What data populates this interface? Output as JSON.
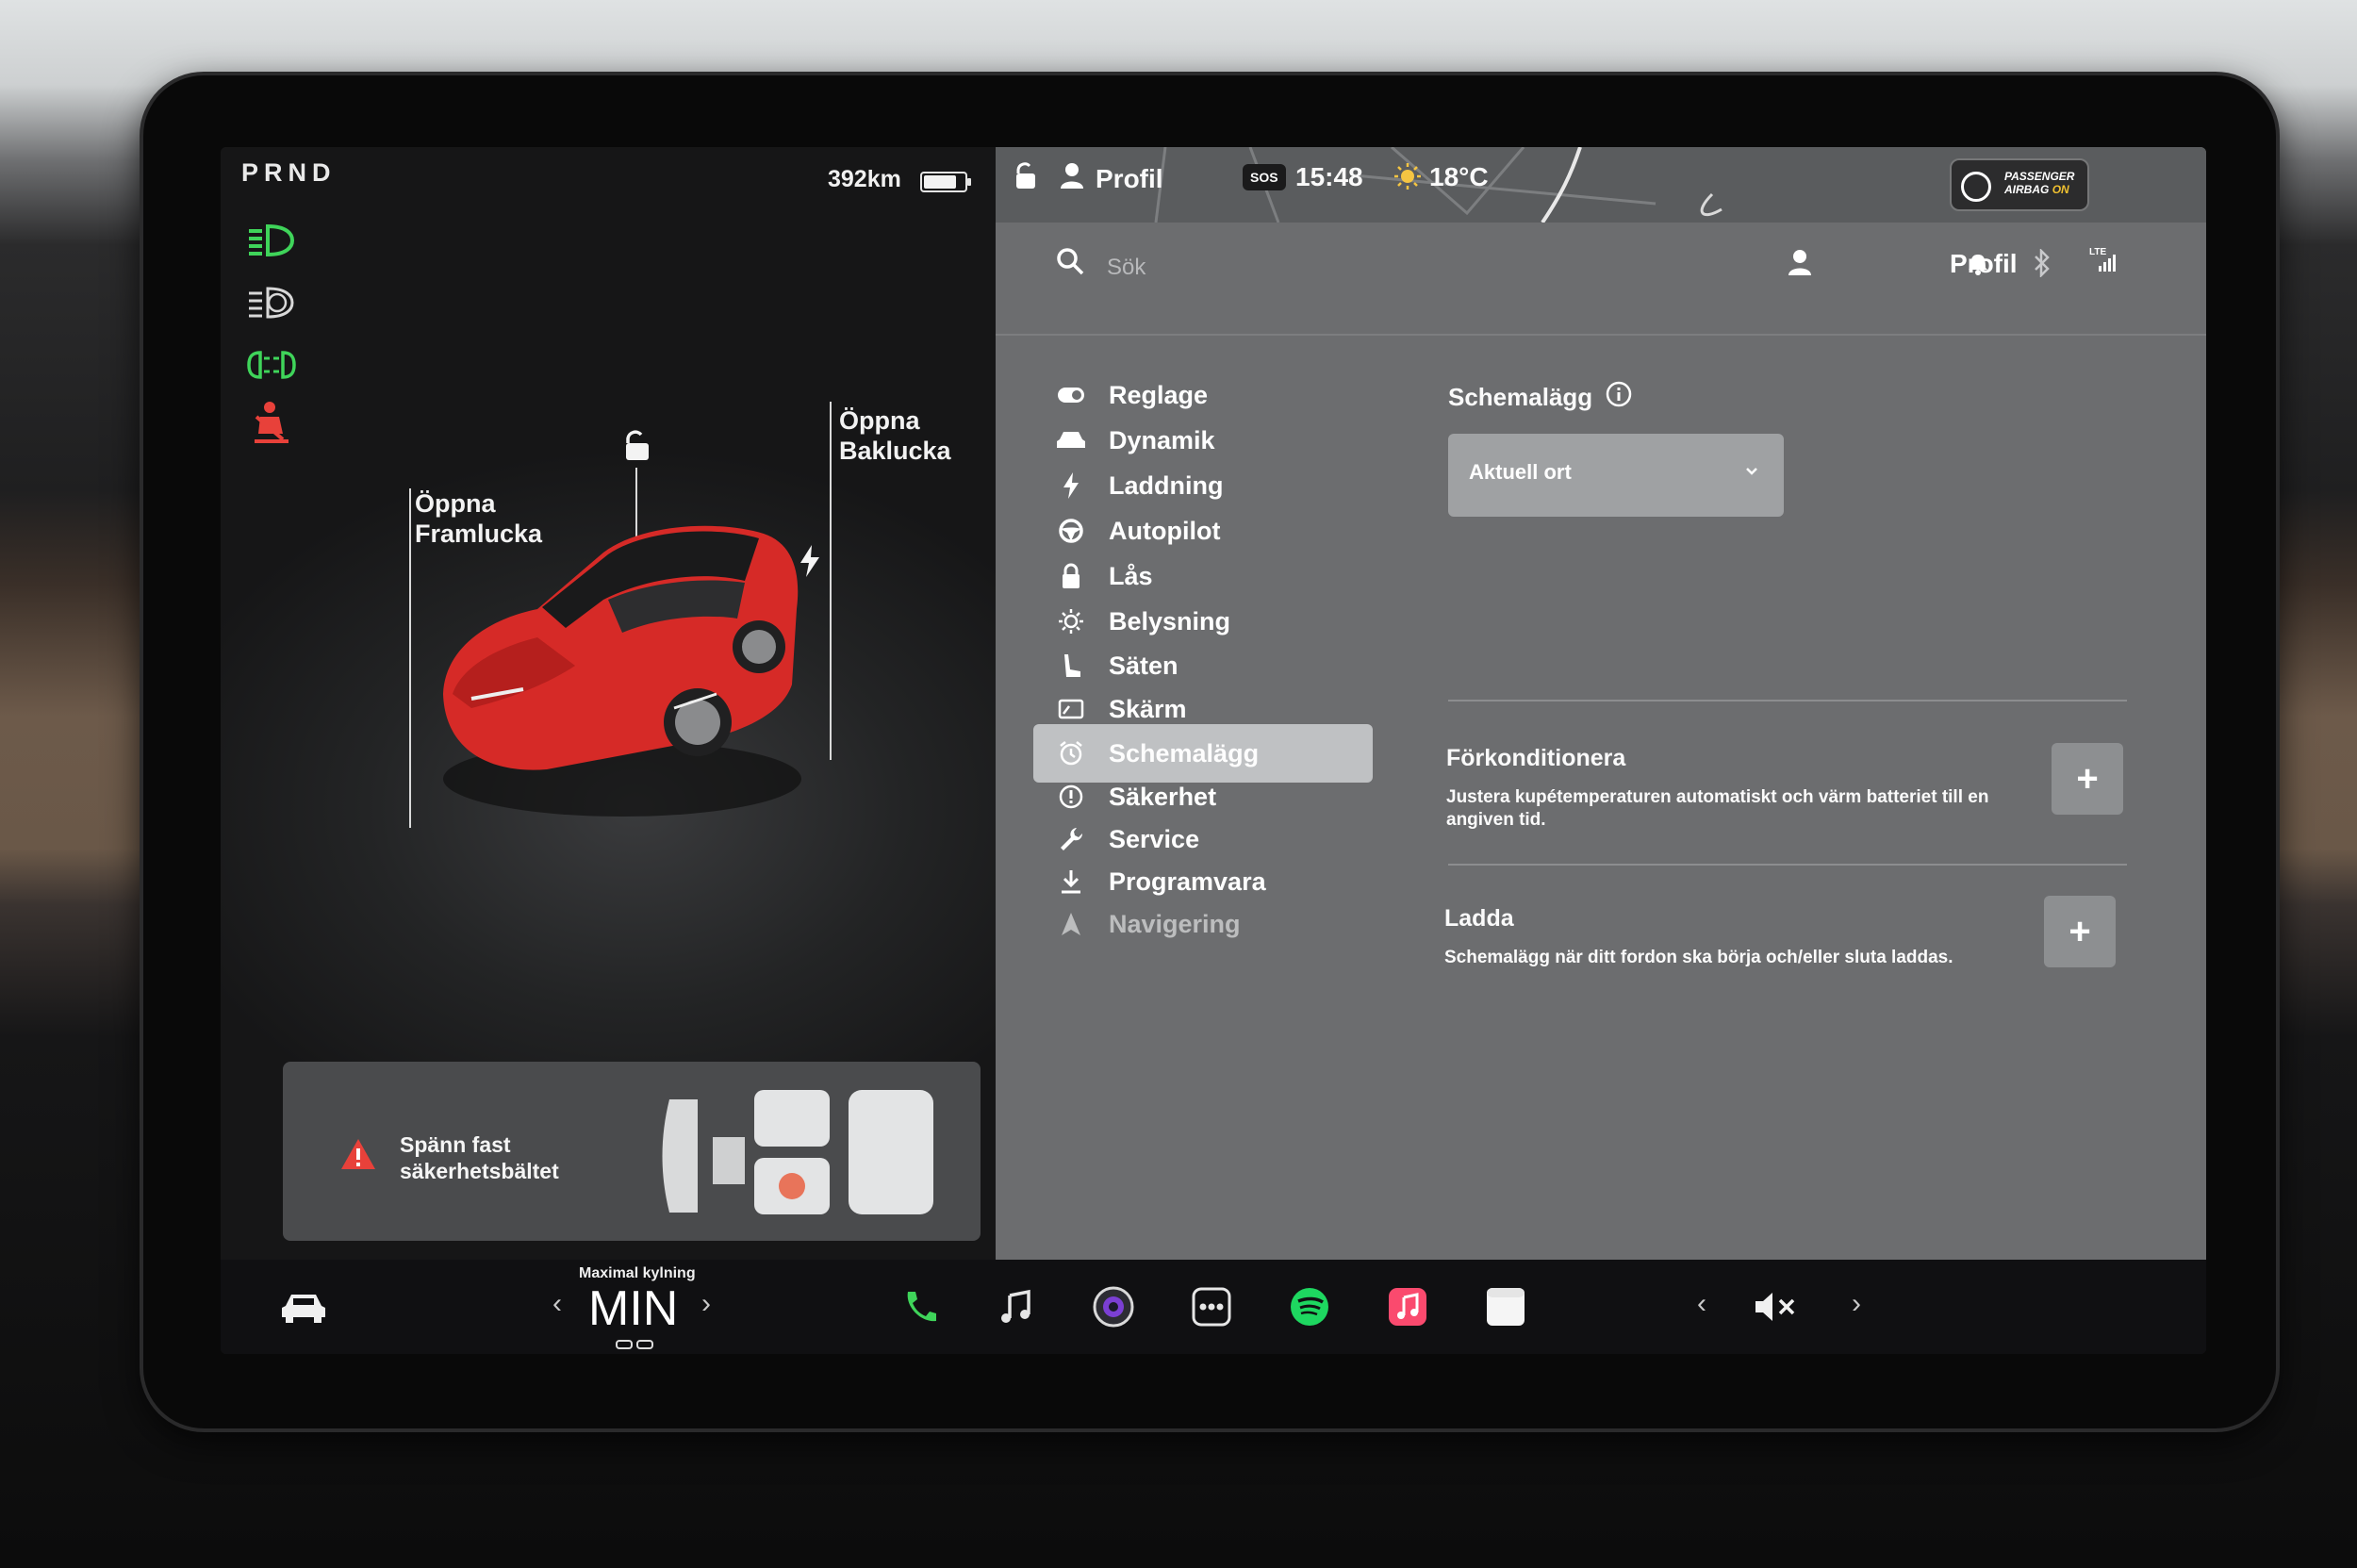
{
  "status": {
    "gear": "PRND",
    "range": "392km",
    "battery_level": 0.8
  },
  "car": {
    "frunk_label_1": "Öppna",
    "frunk_label_2": "Framlucka",
    "trunk_label_1": "Öppna",
    "trunk_label_2": "Baklucka"
  },
  "seatbelt": {
    "line1": "Spänn fast",
    "line2": "säkerhetsbältet"
  },
  "topbar": {
    "profile": "Profil",
    "sos": "SOS",
    "time": "15:48",
    "temp": "18°C",
    "airbag_line1": "PASSENGER",
    "airbag_line2_a": "AIRBAG",
    "airbag_line2_b": "ON"
  },
  "search": {
    "placeholder": "Sök",
    "profile": "Profil",
    "network": "LTE"
  },
  "menu": [
    {
      "label": "Reglage",
      "icon": "toggle-icon"
    },
    {
      "label": "Dynamik",
      "icon": "car-icon"
    },
    {
      "label": "Laddning",
      "icon": "bolt-icon"
    },
    {
      "label": "Autopilot",
      "icon": "steering-wheel-icon"
    },
    {
      "label": "Lås",
      "icon": "lock-icon"
    },
    {
      "label": "Belysning",
      "icon": "sun-icon"
    },
    {
      "label": "Säten",
      "icon": "seat-icon"
    },
    {
      "label": "Skärm",
      "icon": "display-icon"
    },
    {
      "label": "Schemalägg",
      "icon": "alarm-icon"
    },
    {
      "label": "Säkerhet",
      "icon": "safety-icon"
    },
    {
      "label": "Service",
      "icon": "wrench-icon"
    },
    {
      "label": "Programvara",
      "icon": "download-icon"
    },
    {
      "label": "Navigering",
      "icon": "navigation-icon"
    }
  ],
  "schedule": {
    "title": "Schemalägg",
    "dropdown_value": "Aktuell ort",
    "precondition_title": "Förkonditionera",
    "precondition_desc_1": "Justera kupétemperaturen automatiskt och värm batteriet till en",
    "precondition_desc_2": "angiven tid.",
    "charge_title": "Ladda",
    "charge_desc": "Schemalägg när ditt fordon ska börja och/eller sluta laddas.",
    "plus": "+"
  },
  "dock": {
    "climate_label": "Maximal kylning",
    "climate_value": "MIN",
    "chevron_left": "‹",
    "chevron_right": "›"
  },
  "colors": {
    "accent_green": "#3fd45a",
    "warning_red": "#e8413a",
    "car_red": "#d62a27"
  }
}
